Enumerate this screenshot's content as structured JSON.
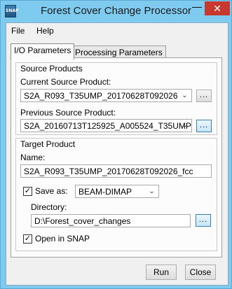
{
  "window": {
    "title": "Forest Cover Change Processor",
    "icon_text": "SNAP",
    "minimize_icon": "minimize-icon",
    "close_icon": "close-icon"
  },
  "menu": {
    "items": [
      "File",
      "Help"
    ]
  },
  "tabs": [
    {
      "label": "I/O Parameters",
      "active": true
    },
    {
      "label": "Processing Parameters",
      "active": false
    }
  ],
  "source_products": {
    "title": "Source Products",
    "current_label": "Current Source Product:",
    "current_value": "S2A_R093_T35UMP_20170628T092026",
    "previous_label": "Previous Source Product:",
    "previous_value": "S2A_20160713T125925_A005524_T35UMP",
    "browse_label": "..."
  },
  "target_product": {
    "title": "Target Product",
    "name_label": "Name:",
    "name_value": "S2A_R093_T35UMP_20170628T092026_fcc",
    "save_as_label": "Save as:",
    "save_as_checked": true,
    "format_value": "BEAM-DIMAP",
    "directory_label": "Directory:",
    "directory_value": "D:\\Forest_cover_changes",
    "browse_label": "...",
    "open_in_snap_label": "Open in SNAP",
    "open_in_snap_checked": true
  },
  "buttons": {
    "run": "Run",
    "close": "Close"
  },
  "colors": {
    "close_button": "#c7382f",
    "frame": "#7fcbf0",
    "panel": "#f0f0f0"
  }
}
